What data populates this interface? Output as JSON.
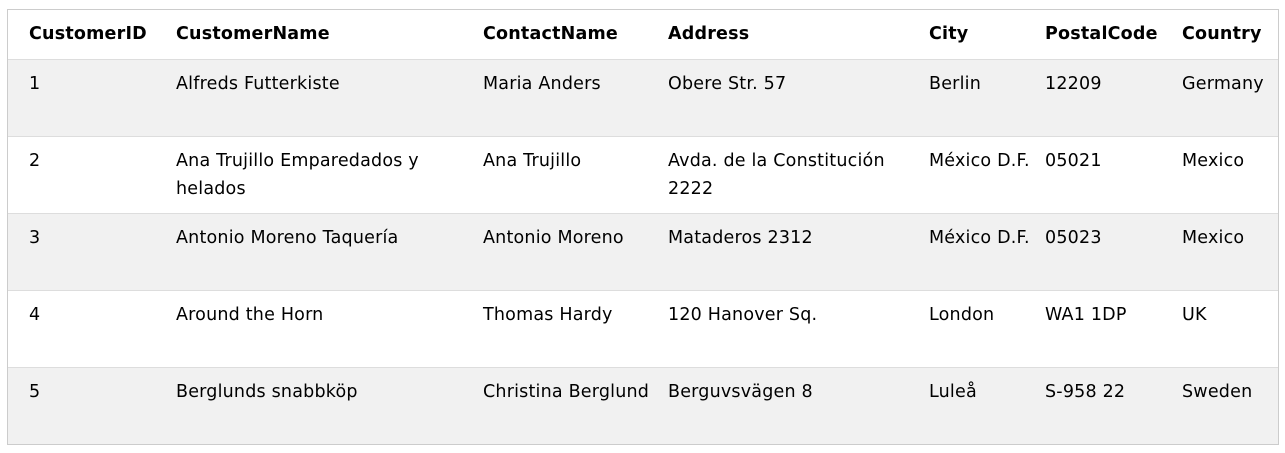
{
  "table": {
    "columns": [
      "CustomerID",
      "CustomerName",
      "ContactName",
      "Address",
      "City",
      "PostalCode",
      "Country"
    ],
    "rows": [
      [
        "1",
        "Alfreds Futterkiste",
        "Maria Anders",
        "Obere Str. 57",
        "Berlin",
        "12209",
        "Germany"
      ],
      [
        "2",
        "Ana Trujillo Emparedados y helados",
        "Ana Trujillo",
        "Avda. de la Constitución 2222",
        "México D.F.",
        "05021",
        "Mexico"
      ],
      [
        "3",
        "Antonio Moreno Taquería",
        "Antonio Moreno",
        "Mataderos 2312",
        "México D.F.",
        "05023",
        "Mexico"
      ],
      [
        "4",
        "Around the Horn",
        "Thomas Hardy",
        "120 Hanover Sq.",
        "London",
        "WA1 1DP",
        "UK"
      ],
      [
        "5",
        "Berglunds snabbköp",
        "Christina Berglund",
        "Berguvsvägen 8",
        "Luleå",
        "S-958 22",
        "Sweden"
      ]
    ]
  },
  "colors": {
    "odd_row": "#f1f1f1",
    "even_row": "#ffffff",
    "border": "#dddddd",
    "outer_border": "#cccccc"
  }
}
